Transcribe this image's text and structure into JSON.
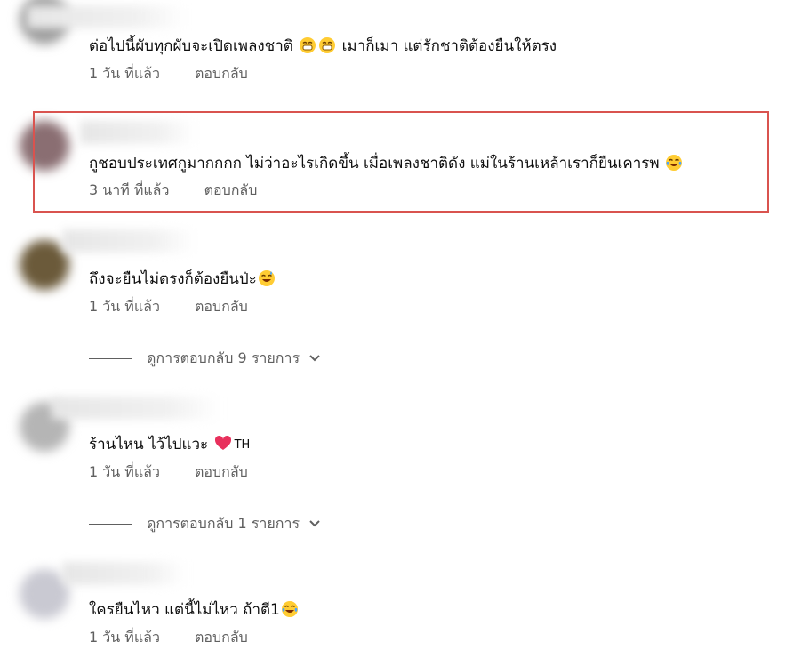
{
  "comments": [
    {
      "text": "ต่อไปนี้ผับทุกผับจะเปิดเพลงชาติ",
      "text_after": "เมาก็เมา แต่รักชาติต้องยืนให้ตรง",
      "time": "1 วัน ที่แล้ว",
      "reply": "ตอบกลับ"
    },
    {
      "text": "กูชอบประเทศกูมากกกก ไม่ว่าอะไรเกิดขึ้น เมื่อเพลงชาติดัง แม่ในร้านเหล้าเราก็ยืนเคารพ",
      "time": "3 นาที ที่แล้ว",
      "reply": "ตอบกลับ",
      "highlighted": true
    },
    {
      "text": "ถึงจะยืนไม่ตรงก็ต้องยืนป่ะ",
      "time": "1 วัน ที่แล้ว",
      "reply": "ตอบกลับ",
      "view_replies": "ดูการตอบกลับ 9 รายการ"
    },
    {
      "text": "ร้านไหน ไว้ไปแวะ",
      "badge": "TH",
      "time": "1 วัน ที่แล้ว",
      "reply": "ตอบกลับ",
      "view_replies": "ดูการตอบกลับ 1 รายการ"
    },
    {
      "text": "ใครยืนไหว แต่นี้ไม่ไหว ถ้าตี1",
      "time": "1 วัน ที่แล้ว",
      "reply": "ตอบกลับ"
    }
  ],
  "icons": {
    "grin": "grinning-face-icon",
    "laugh": "tears-of-joy-icon",
    "sweat": "sweat-smile-icon",
    "heart": "heart-icon",
    "chevron": "chevron-down-icon"
  },
  "colors": {
    "highlight_border": "#d9534f",
    "meta_text": "#606060"
  }
}
